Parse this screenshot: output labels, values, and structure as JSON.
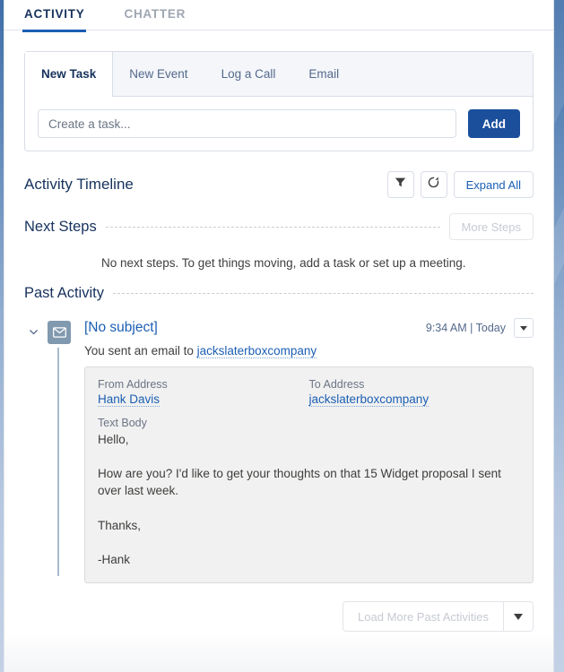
{
  "top_tabs": [
    {
      "label": "ACTIVITY",
      "active": true
    },
    {
      "label": "CHATTER",
      "active": false
    }
  ],
  "composer": {
    "tabs": [
      {
        "label": "New Task",
        "active": true
      },
      {
        "label": "New Event",
        "active": false
      },
      {
        "label": "Log a Call",
        "active": false
      },
      {
        "label": "Email",
        "active": false
      }
    ],
    "input_placeholder": "Create a task...",
    "input_value": "",
    "add_label": "Add"
  },
  "timeline": {
    "title": "Activity Timeline",
    "filter_icon": "filter-funnel-icon",
    "refresh_icon": "refresh-icon",
    "expand_all_label": "Expand All"
  },
  "next_steps": {
    "label": "Next Steps",
    "more_steps_label": "More Steps",
    "empty_message": "No next steps. To get things moving, add a task or set up a meeting."
  },
  "past_activity": {
    "label": "Past Activity",
    "item": {
      "icon": "email-envelope-icon",
      "expand_icon": "chevron-down-icon",
      "subject": "[No subject]",
      "timestamp": "9:34 AM | Today",
      "dropdown_icon": "caret-down-icon",
      "summary_prefix": "You sent an email to ",
      "summary_link": "jackslaterboxcompany",
      "detail": {
        "from_label": "From Address",
        "from_value": "Hank Davis",
        "to_label": "To Address",
        "to_value": "jackslaterboxcompany",
        "body_label": "Text Body",
        "body_text": "Hello,\n\nHow are you? I'd like to get your thoughts on that 15 Widget proposal I sent over last week.\n\nThanks,\n\n-Hank"
      }
    },
    "load_more_label": "Load More Past Activities",
    "load_more_arrow_icon": "caret-down-icon"
  },
  "colors": {
    "accent_blue": "#1b5eb3",
    "navy": "#16325c",
    "button_blue": "#1b4f9c",
    "icon_slate": "#8199af"
  }
}
